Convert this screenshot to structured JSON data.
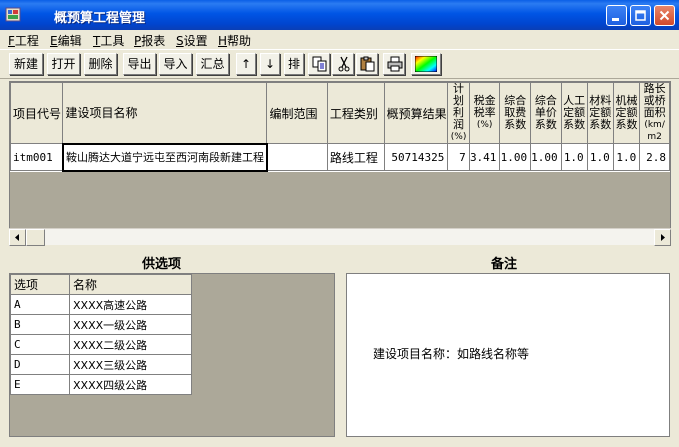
{
  "window": {
    "title": "概预算工程管理",
    "icon": "app-icon"
  },
  "menu": [
    {
      "key": "F",
      "label": "工程"
    },
    {
      "key": "E",
      "label": "编辑"
    },
    {
      "key": "T",
      "label": "工具"
    },
    {
      "key": "P",
      "label": "报表"
    },
    {
      "key": "S",
      "label": "设置"
    },
    {
      "key": "H",
      "label": "帮助"
    }
  ],
  "toolbar": {
    "new": "新建",
    "open": "打开",
    "delete": "删除",
    "export": "导出",
    "import": "导入",
    "summary": "汇总",
    "up": "↑",
    "down": "↓",
    "sort": "排"
  },
  "grid": {
    "columns": [
      {
        "label": "项目代号"
      },
      {
        "label": "建设项目名称"
      },
      {
        "label": "编制范围"
      },
      {
        "label": "工程类别"
      },
      {
        "label": "概预算结果"
      },
      {
        "label": "计划利润",
        "unit": "(%)"
      },
      {
        "label": "税金税率",
        "unit": "(%)"
      },
      {
        "label": "综合取费系数"
      },
      {
        "label": "综合单价系数"
      },
      {
        "label": "人工定额系数"
      },
      {
        "label": "材料定额系数"
      },
      {
        "label": "机械定额系数"
      },
      {
        "label": "路长或桥面积",
        "unit": "(km/m2"
      }
    ],
    "rows": [
      {
        "code": "itm001",
        "name": "鞍山腾达大道宁远屯至西河南段新建工程",
        "scope": "",
        "category": "路线工程",
        "result": "50714325",
        "profit": "7",
        "tax": "3.41",
        "fee_coef": "1.00",
        "unit_coef": "1.00",
        "labor_coef": "1.0",
        "material_coef": "1.0",
        "machine_coef": "1.0",
        "length": "2.8"
      }
    ]
  },
  "options": {
    "title": "供选项",
    "headers": {
      "key": "选项",
      "name": "名称"
    },
    "items": [
      {
        "key": "A",
        "name": "XXXX高速公路"
      },
      {
        "key": "B",
        "name": "XXXX一级公路"
      },
      {
        "key": "C",
        "name": "XXXX二级公路"
      },
      {
        "key": "D",
        "name": "XXXX三级公路"
      },
      {
        "key": "E",
        "name": "XXXX四级公路"
      }
    ]
  },
  "notes": {
    "title": "备注",
    "text": "建设项目名称：如路线名称等"
  },
  "colors": {
    "titlebar": "#0055e5",
    "window_bg": "#ece9d8",
    "grid_empty": "#aca899",
    "close_button": "#d2492a"
  }
}
